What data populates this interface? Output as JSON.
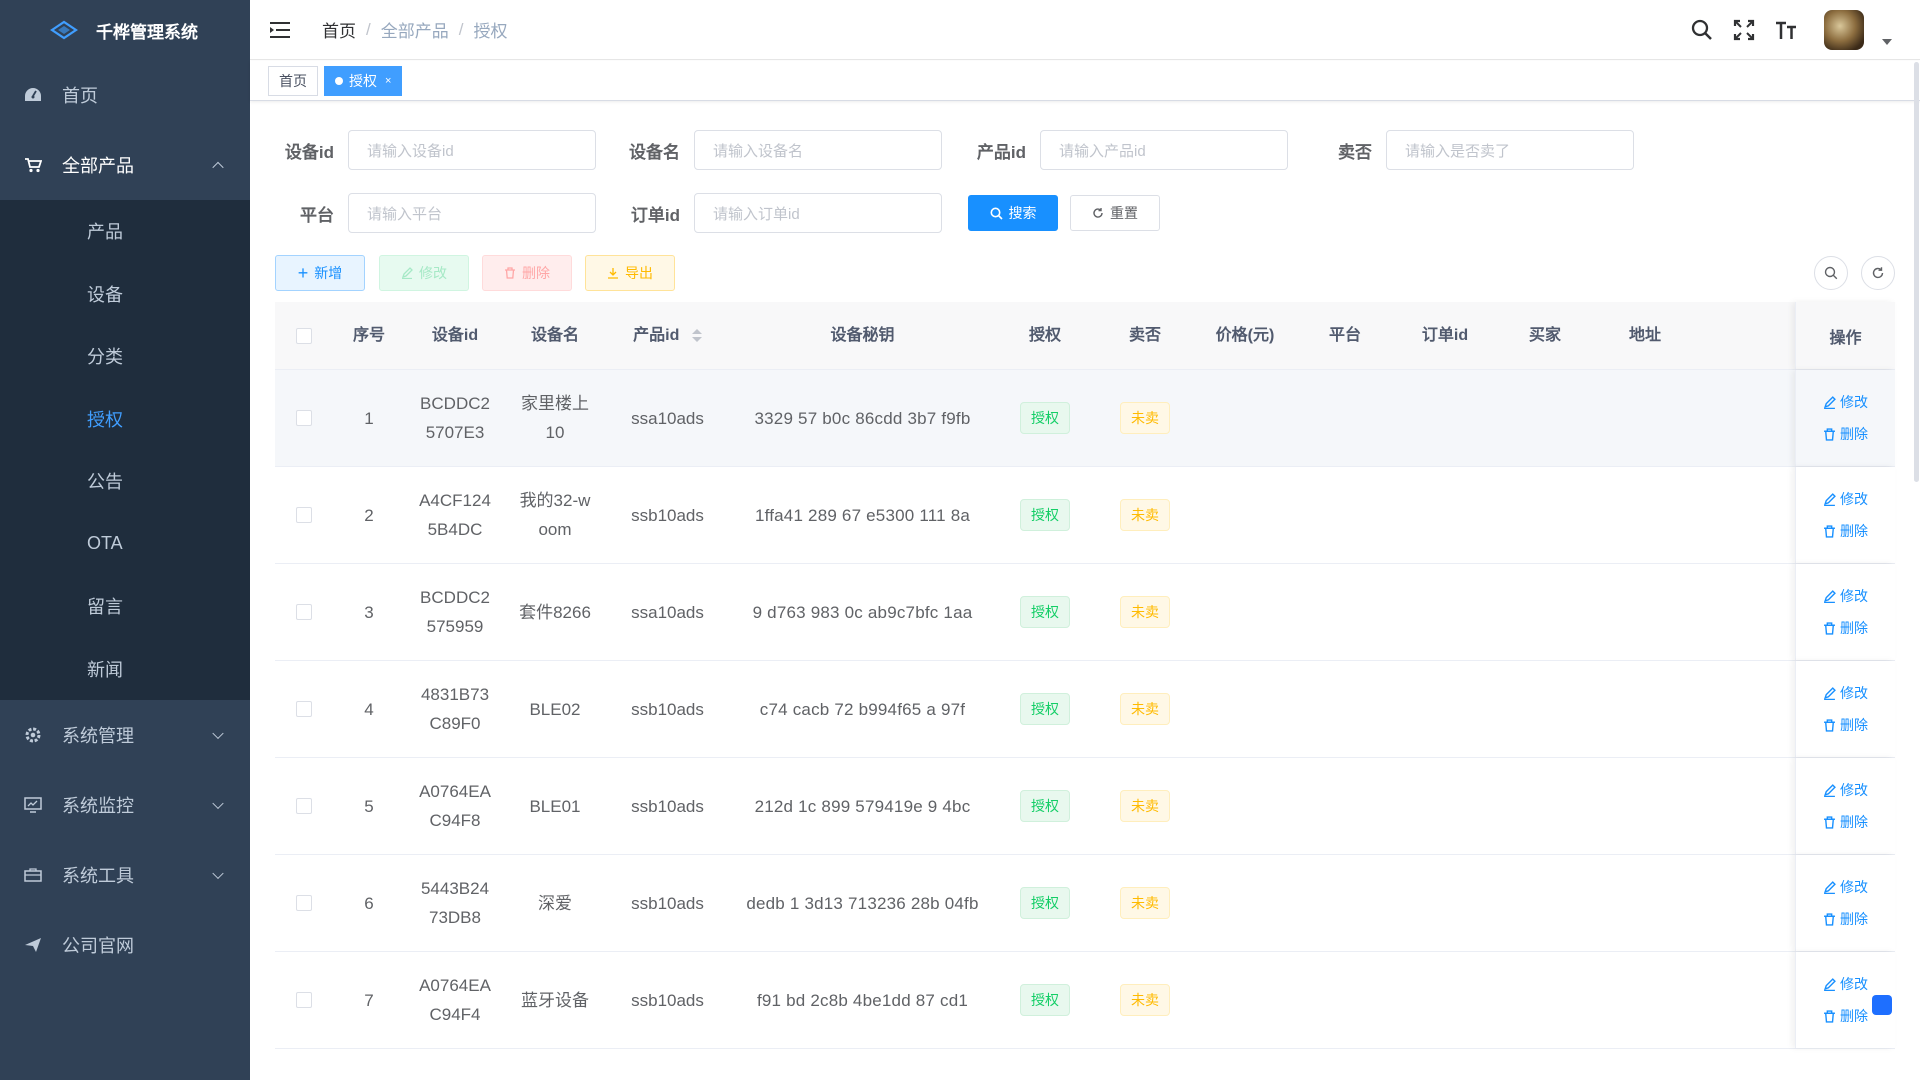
{
  "app": {
    "title": "千桦管理系统"
  },
  "sidebar": {
    "items": [
      {
        "label": "首页",
        "icon": "dashboard-icon"
      },
      {
        "label": "全部产品",
        "icon": "cart-icon",
        "expanded": true,
        "children": [
          "产品",
          "设备",
          "分类",
          "授权",
          "公告",
          "OTA",
          "留言",
          "新闻"
        ],
        "active_child": "授权"
      },
      {
        "label": "系统管理",
        "icon": "gear-icon"
      },
      {
        "label": "系统监控",
        "icon": "monitor-icon"
      },
      {
        "label": "系统工具",
        "icon": "toolbox-icon"
      },
      {
        "label": "公司官网",
        "icon": "send-icon"
      }
    ]
  },
  "navbar": {
    "breadcrumb": [
      "首页",
      "全部产品",
      "授权"
    ],
    "icons": [
      "search-icon",
      "fullscreen-icon",
      "font-size-icon"
    ]
  },
  "tags": {
    "home": "首页",
    "current": "授权",
    "close": "×"
  },
  "search": {
    "device_id": {
      "label": "设备id",
      "placeholder": "请输入设备id"
    },
    "device_name": {
      "label": "设备名",
      "placeholder": "请输入设备名"
    },
    "product_id": {
      "label": "产品id",
      "placeholder": "请输入产品id"
    },
    "sold": {
      "label": "卖否",
      "placeholder": "请输入是否卖了"
    },
    "platform": {
      "label": "平台",
      "placeholder": "请输入平台"
    },
    "order_id": {
      "label": "订单id",
      "placeholder": "请输入订单id"
    },
    "search_btn": "搜索",
    "reset_btn": "重置"
  },
  "toolbar": {
    "add": "新增",
    "edit": "修改",
    "delete": "删除",
    "export": "导出"
  },
  "table": {
    "columns": [
      "序号",
      "设备id",
      "设备名",
      "产品id",
      "设备秘钥",
      "授权",
      "卖否",
      "价格(元)",
      "平台",
      "订单id",
      "买家",
      "地址",
      "操作"
    ],
    "rows": [
      {
        "idx": "1",
        "dev_id": [
          "BCDDC2",
          "5707E3"
        ],
        "dev_name": [
          "家里楼上",
          "10"
        ],
        "product": "ssa10ads",
        "secret": "3329 57 b0c 86cdd 3b7 f9fb",
        "auth": "授权",
        "sold": "未卖"
      },
      {
        "idx": "2",
        "dev_id": [
          "A4CF124",
          "5B4DC"
        ],
        "dev_name": [
          "我的32-w",
          "oom"
        ],
        "product": "ssb10ads",
        "secret": "1ffa41 289 67 e5300 111 8a",
        "auth": "授权",
        "sold": "未卖"
      },
      {
        "idx": "3",
        "dev_id": [
          "BCDDC2",
          "575959"
        ],
        "dev_name": [
          "套件8266",
          ""
        ],
        "product": "ssa10ads",
        "secret": "9 d763 983 0c ab9c7bfc 1aa",
        "auth": "授权",
        "sold": "未卖"
      },
      {
        "idx": "4",
        "dev_id": [
          "4831B73",
          "C89F0"
        ],
        "dev_name": [
          "BLE02",
          ""
        ],
        "product": "ssb10ads",
        "secret": "c74 cacb 72 b994f65 a 97f",
        "auth": "授权",
        "sold": "未卖"
      },
      {
        "idx": "5",
        "dev_id": [
          "A0764EA",
          "C94F8"
        ],
        "dev_name": [
          "BLE01",
          ""
        ],
        "product": "ssb10ads",
        "secret": "212d 1c 899 579419e 9 4bc",
        "auth": "授权",
        "sold": "未卖"
      },
      {
        "idx": "6",
        "dev_id": [
          "5443B24",
          "73DB8"
        ],
        "dev_name": [
          "深爱",
          ""
        ],
        "product": "ssb10ads",
        "secret": "dedb 1 3d13 713236 28b 04fb",
        "auth": "授权",
        "sold": "未卖"
      },
      {
        "idx": "7",
        "dev_id": [
          "A0764EA",
          "C94F4"
        ],
        "dev_name": [
          "蓝牙设备",
          ""
        ],
        "product": "ssb10ads",
        "secret": "f91 bd 2c8b 4be1dd 87 cd1",
        "auth": "授权",
        "sold": "未卖"
      }
    ],
    "op_edit": "修改",
    "op_delete": "删除"
  }
}
